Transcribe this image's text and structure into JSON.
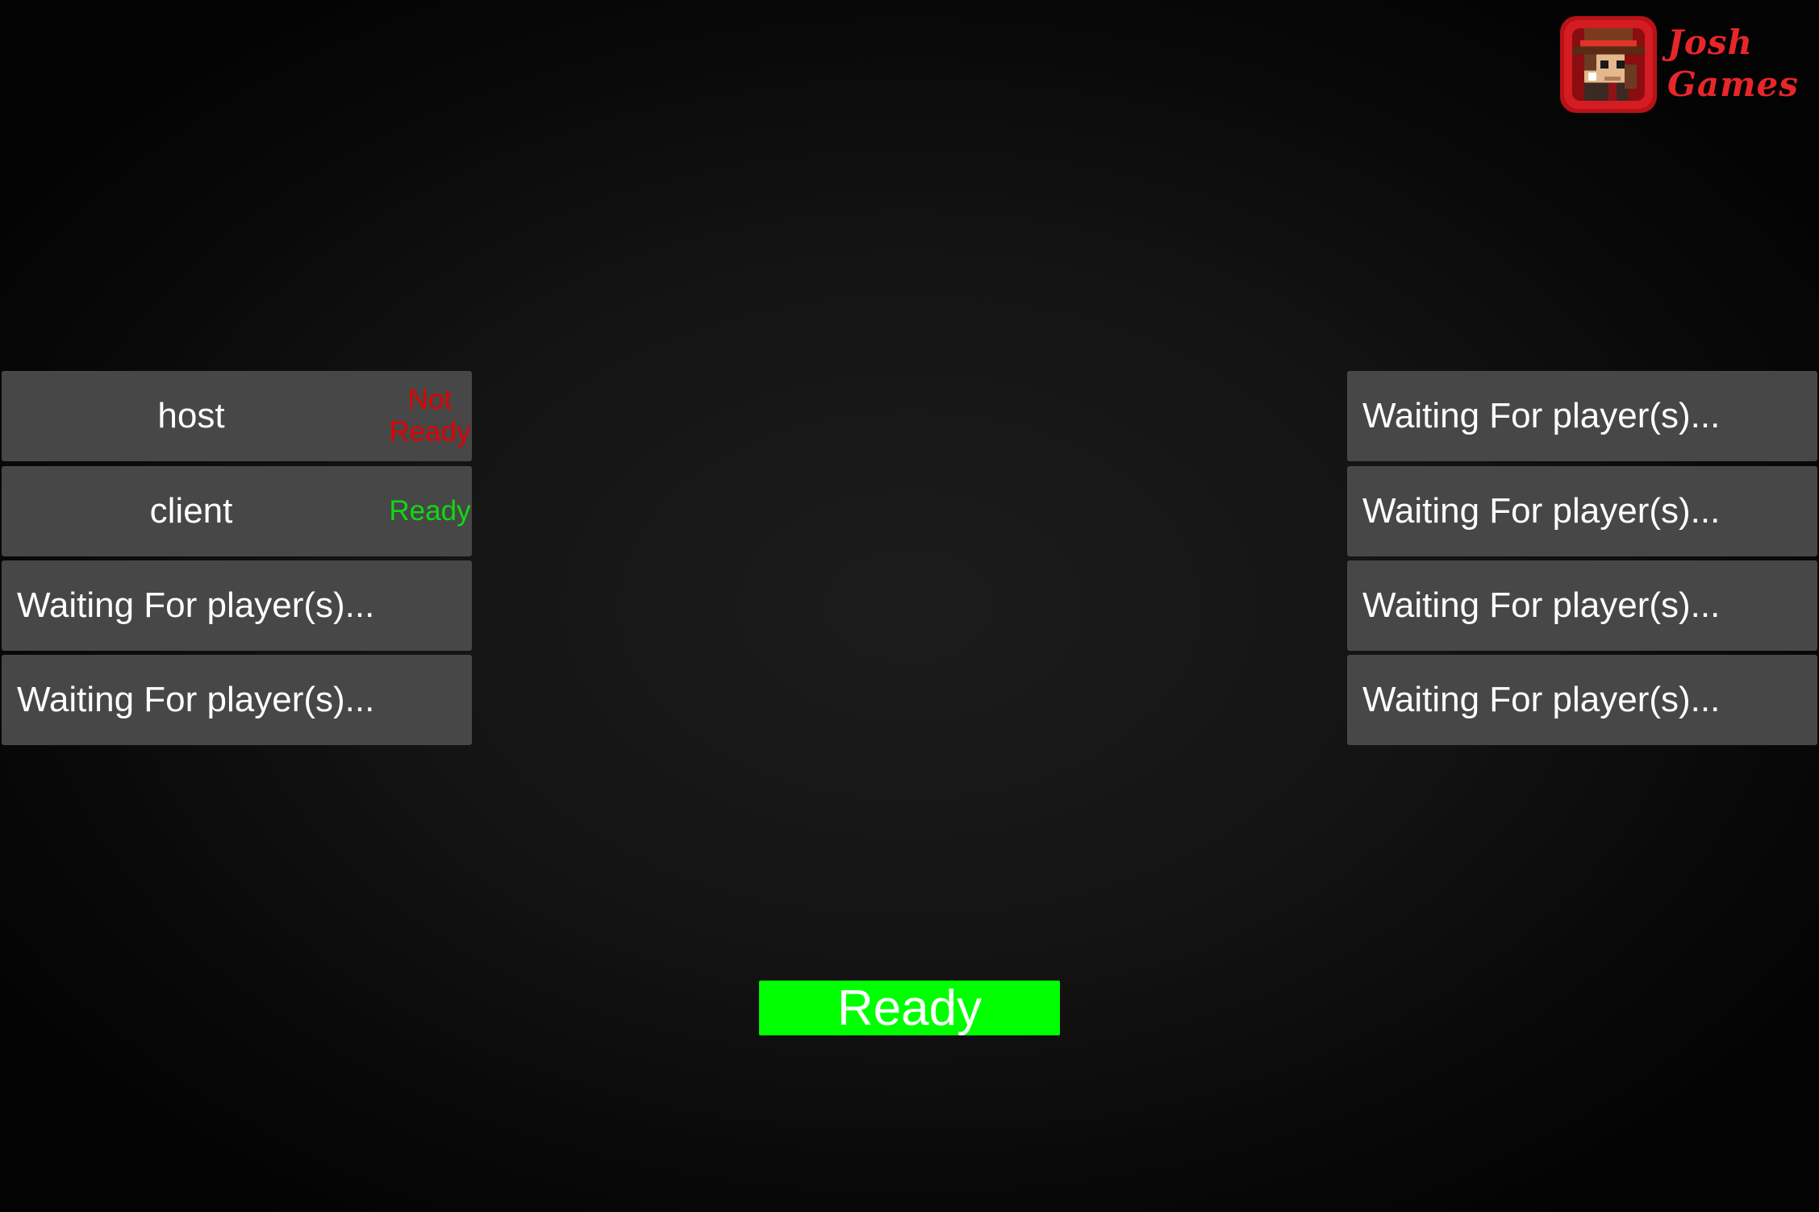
{
  "logo": {
    "line1": "Josh",
    "line2": "Games",
    "icon": "pixel-adventurer-icon",
    "color": "#e8262a"
  },
  "left_slots": [
    {
      "name": "host",
      "status": [
        "Not",
        "Ready"
      ],
      "status_color": "#e00000"
    },
    {
      "name": "client",
      "status": [
        "Ready"
      ],
      "status_color": "#14d614"
    },
    {
      "waiting_text": "Waiting For player(s)..."
    },
    {
      "waiting_text": "Waiting For player(s)..."
    }
  ],
  "right_slots": [
    {
      "waiting_text": "Waiting For player(s)..."
    },
    {
      "waiting_text": "Waiting For player(s)..."
    },
    {
      "waiting_text": "Waiting For player(s)..."
    },
    {
      "waiting_text": "Waiting For player(s)..."
    }
  ],
  "ready_button": {
    "label": "Ready",
    "color": "#00ff00"
  }
}
